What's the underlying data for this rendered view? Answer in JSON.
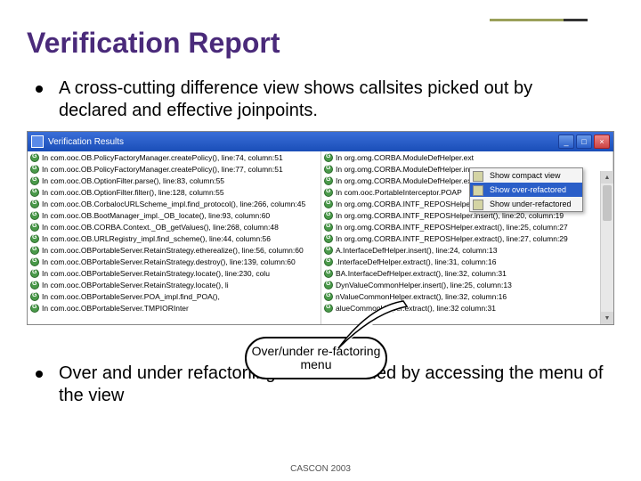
{
  "title": "Verification Report",
  "bullet1": "A cross-cutting difference view shows callsites picked out by declared and effective joinpoints.",
  "bullet2": "Over and under refactoriing can be verified by accessing the menu of the view",
  "callout": "Over/under re-factoring menu",
  "footer": "CASCON 2003",
  "window": {
    "title": "Verification Results",
    "menu": {
      "item1": "Show compact view",
      "item2": "Show over-refactored",
      "item3": "Show under-refactored"
    }
  },
  "leftRows": [
    "In com.ooc.OB.PolicyFactoryManager.createPolicy(), line:74, column:51",
    "In com.ooc.OB.PolicyFactoryManager.createPolicy(), line:77, column:51",
    "In com.ooc.OB.OptionFilter.parse(), line:83, column:55",
    "In com.ooc.OB.OptionFilter.filter(), line:128, column:55",
    "In com.ooc.OB.CorbalocURLScheme_impl.find_protocol(), line:266, column:45",
    "In com.ooc.OB.BootManager_impl._OB_locate(), line:93, column:60",
    "In com.ooc.OB.CORBA.Context._OB_getValues(), line:268, column:48",
    "In com.ooc.OB.URLRegistry_impl.find_scheme(), line:44, column:56",
    "In com.ooc.OBPortableServer.RetainStrategy.etherealize(), line:56, column:60",
    "In com.ooc.OBPortableServer.RetainStrategy.destroy(), line:139, column:60",
    "In com.ooc.OBPortableServer.RetainStrategy.locate(), line:230, colu",
    "In com.ooc.OBPortableServer.RetainStrategy.locate(), li",
    "In com.ooc.OBPortableServer.POA_impl.find_POA(),",
    "In com.ooc.OBPortableServer.TMPIORInter"
  ],
  "rightRows": [
    "In org.omg.CORBA.ModuleDefHelper.ext",
    "In org.omg.CORBA.ModuleDefHelper.ins",
    "In org.omg.CORBA.ModuleDefHelper.ext",
    "In com.ooc.PortableInterceptor.POAP",
    "In org.omg.CORBA.INTF_REPOSHelper.e                                      7, col",
    "In org.omg.CORBA.INTF_REPOSHelper.insert(), line:20, column:19",
    "In org.omg.CORBA.INTF_REPOSHelper.extract(), line:25, column:27",
    "In org.omg.CORBA.INTF_REPOSHelper.extract(), line:27, column:29",
    "                                                     A.InterfaceDefHelper.insert(), line:24, column:13",
    "                                                      .InterfaceDefHelper.extract(), line:31, column:16",
    "                                                    BA.InterfaceDefHelper.extract(), line:32, column:31",
    "                                                         DynValueCommonHelper.insert(), line:25, column:13",
    "                                                         nValueCommonHelper.extract(), line:32, column:16",
    "                                                           alueCommonHelper.extract(), line:32  column:31"
  ]
}
